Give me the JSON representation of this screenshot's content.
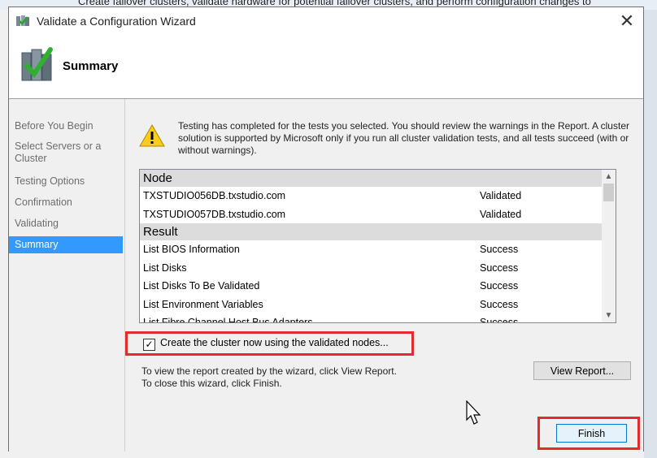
{
  "background": {
    "top_text": "Create failover clusters, validate hardware for potential failover clusters, and perform configuration changes to"
  },
  "window": {
    "title": "Validate a Configuration Wizard",
    "close_glyph": "✕"
  },
  "header": {
    "title": "Summary"
  },
  "nav": {
    "items": [
      {
        "label": "Before You Begin"
      },
      {
        "label": "Select Servers or a Cluster"
      },
      {
        "label": "Testing Options"
      },
      {
        "label": "Confirmation"
      },
      {
        "label": "Validating"
      },
      {
        "label": "Summary",
        "active": true
      }
    ]
  },
  "content": {
    "warning_text": "Testing has completed for the tests you selected. You should review the warnings in the Report.  A cluster solution is supported by Microsoft only if you run all cluster validation tests, and all tests succeed (with or without warnings).",
    "grid": {
      "node_header": "Node",
      "nodes": [
        {
          "name": "TXSTUDIO056DB.txstudio.com",
          "status": "Validated"
        },
        {
          "name": "TXSTUDIO057DB.txstudio.com",
          "status": "Validated"
        }
      ],
      "result_header": "Result",
      "results": [
        {
          "name": "List BIOS Information",
          "status": "Success"
        },
        {
          "name": "List Disks",
          "status": "Success"
        },
        {
          "name": "List Disks To Be Validated",
          "status": "Success"
        },
        {
          "name": "List Environment Variables",
          "status": "Success"
        },
        {
          "name": "List Fibre Channel Host Bus Adapters",
          "status": "Success"
        }
      ]
    },
    "checkbox": {
      "label": "Create the cluster now using the validated nodes...",
      "checked": true
    },
    "info_line1": "To view the report created by the wizard, click View Report.",
    "info_line2": "To close this wizard, click Finish.",
    "view_report_label": "View Report...",
    "finish_label": "Finish"
  },
  "colors": {
    "accent": "#3399ff",
    "highlight_red": "#e32b2b"
  }
}
